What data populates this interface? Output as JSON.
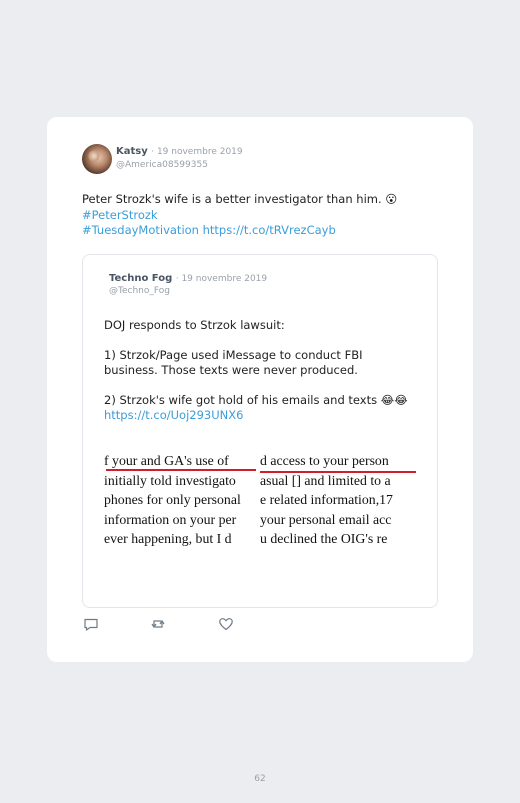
{
  "tweet": {
    "author_name": "Katsy",
    "date": "· 19 novembre 2019",
    "handle": "@America08599355",
    "text_lines": [
      "Peter Strozk's wife is a better investigator than him. 😮"
    ],
    "hashtag1": "#PeterStrozk",
    "hashtag2": "#TuesdayMotivation",
    "link": "https://t.co/tRVrezCayb"
  },
  "quote": {
    "author_name": "Techno Fog",
    "date": "· 19 novembre 2019",
    "handle": "@Techno_Fog",
    "line1": "DOJ responds to Strzok lawsuit:",
    "line2": "1) Strzok/Page used iMessage to conduct FBI",
    "line3": "business. Those texts were never produced.",
    "line4": "2) Strzok's wife got hold of his emails and texts 😂😂",
    "link": "https://t.co/Uoj293UNX6",
    "image_left": [
      "f your and GA's use of",
      "initially told investigato",
      "phones for only personal",
      "information on your per",
      "ever happening, but I d"
    ],
    "image_right": [
      "d access to your person",
      "asual [] and limited to a",
      "e related information,17",
      "your personal email acc",
      "u declined the OIG's re"
    ]
  },
  "actions": {
    "reply": "reply-icon",
    "retweet": "retweet-icon",
    "like": "heart-icon"
  },
  "footer": {
    "page_number": "62"
  }
}
